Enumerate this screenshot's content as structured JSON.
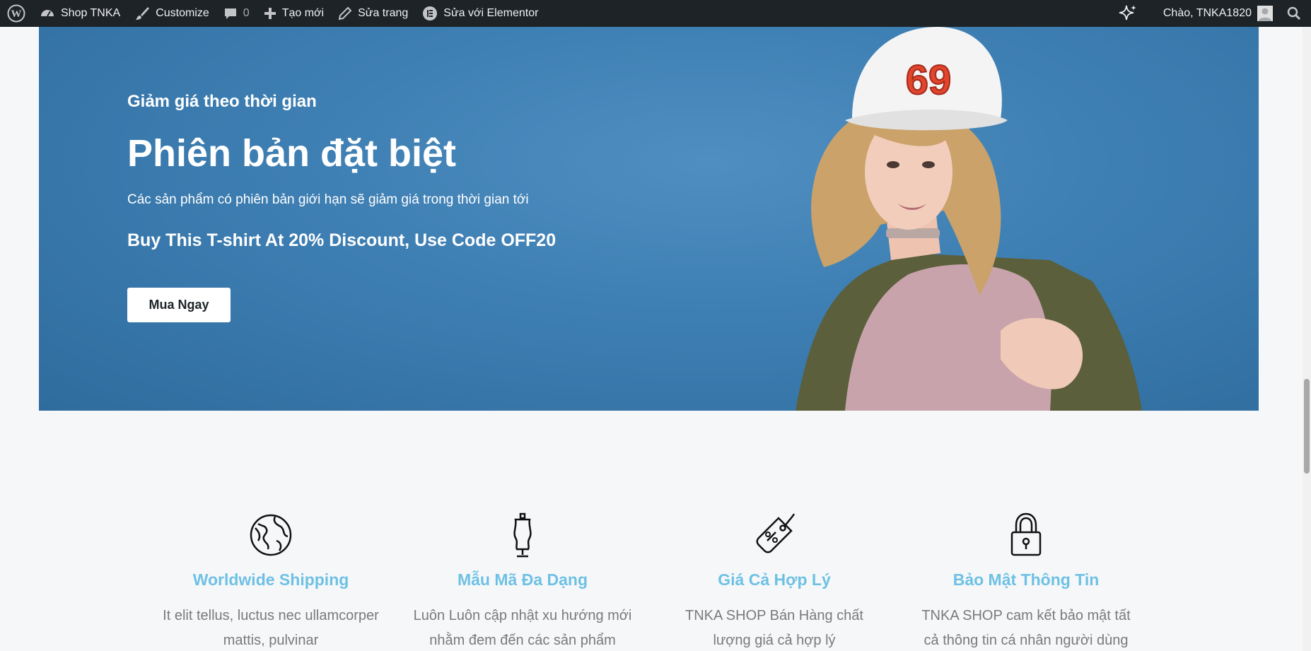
{
  "adminbar": {
    "site_name": "Shop TNKA",
    "customize": "Customize",
    "comments_count": "0",
    "new": "Tạo mới",
    "edit_page": "Sửa trang",
    "edit_elementor": "Sửa với Elementor",
    "greeting": "Chào, TNKA1820",
    "icons": [
      "wordpress-icon",
      "dashboard-icon",
      "brush-icon",
      "comment-icon",
      "plus-icon",
      "pencil-icon",
      "elementor-icon",
      "sparkle-icon",
      "avatar",
      "search-icon"
    ]
  },
  "hero": {
    "subtitle": "Giảm giá theo thời gian",
    "title": "Phiên bản đặt biệt",
    "description": "Các sản phẩm có phiên bản giới hạn sẽ giảm giá trong thời gian tới",
    "promo": "Buy This T-shirt At 20% Discount, Use Code OFF20",
    "button": "Mua Ngay",
    "cap_number": "69"
  },
  "features": [
    {
      "icon": "globe-icon",
      "title": "Worldwide Shipping",
      "text": "It elit tellus, luctus nec ullamcorper mattis, pulvinar"
    },
    {
      "icon": "mannequin-icon",
      "title": "Mẫu Mã Đa Dạng",
      "text": "Luôn Luôn cập nhật xu hướng mới nhằm đem đến các sản phẩm"
    },
    {
      "icon": "price-tag-icon",
      "title": "Giá Cả Hợp Lý",
      "text": "TNKA SHOP Bán Hàng chất lượng giá cả hợp lý"
    },
    {
      "icon": "padlock-icon",
      "title": "Bảo Mật Thông Tin",
      "text": "TNKA SHOP cam kết bảo mật tất cả thông tin cá nhân người dùng"
    }
  ],
  "colors": {
    "adminbar_bg": "#1d2327",
    "hero_bg": "#3f80b4",
    "feature_title": "#6ec1e4",
    "feature_text": "#7a7a7a",
    "page_bg": "#f6f7f9"
  }
}
